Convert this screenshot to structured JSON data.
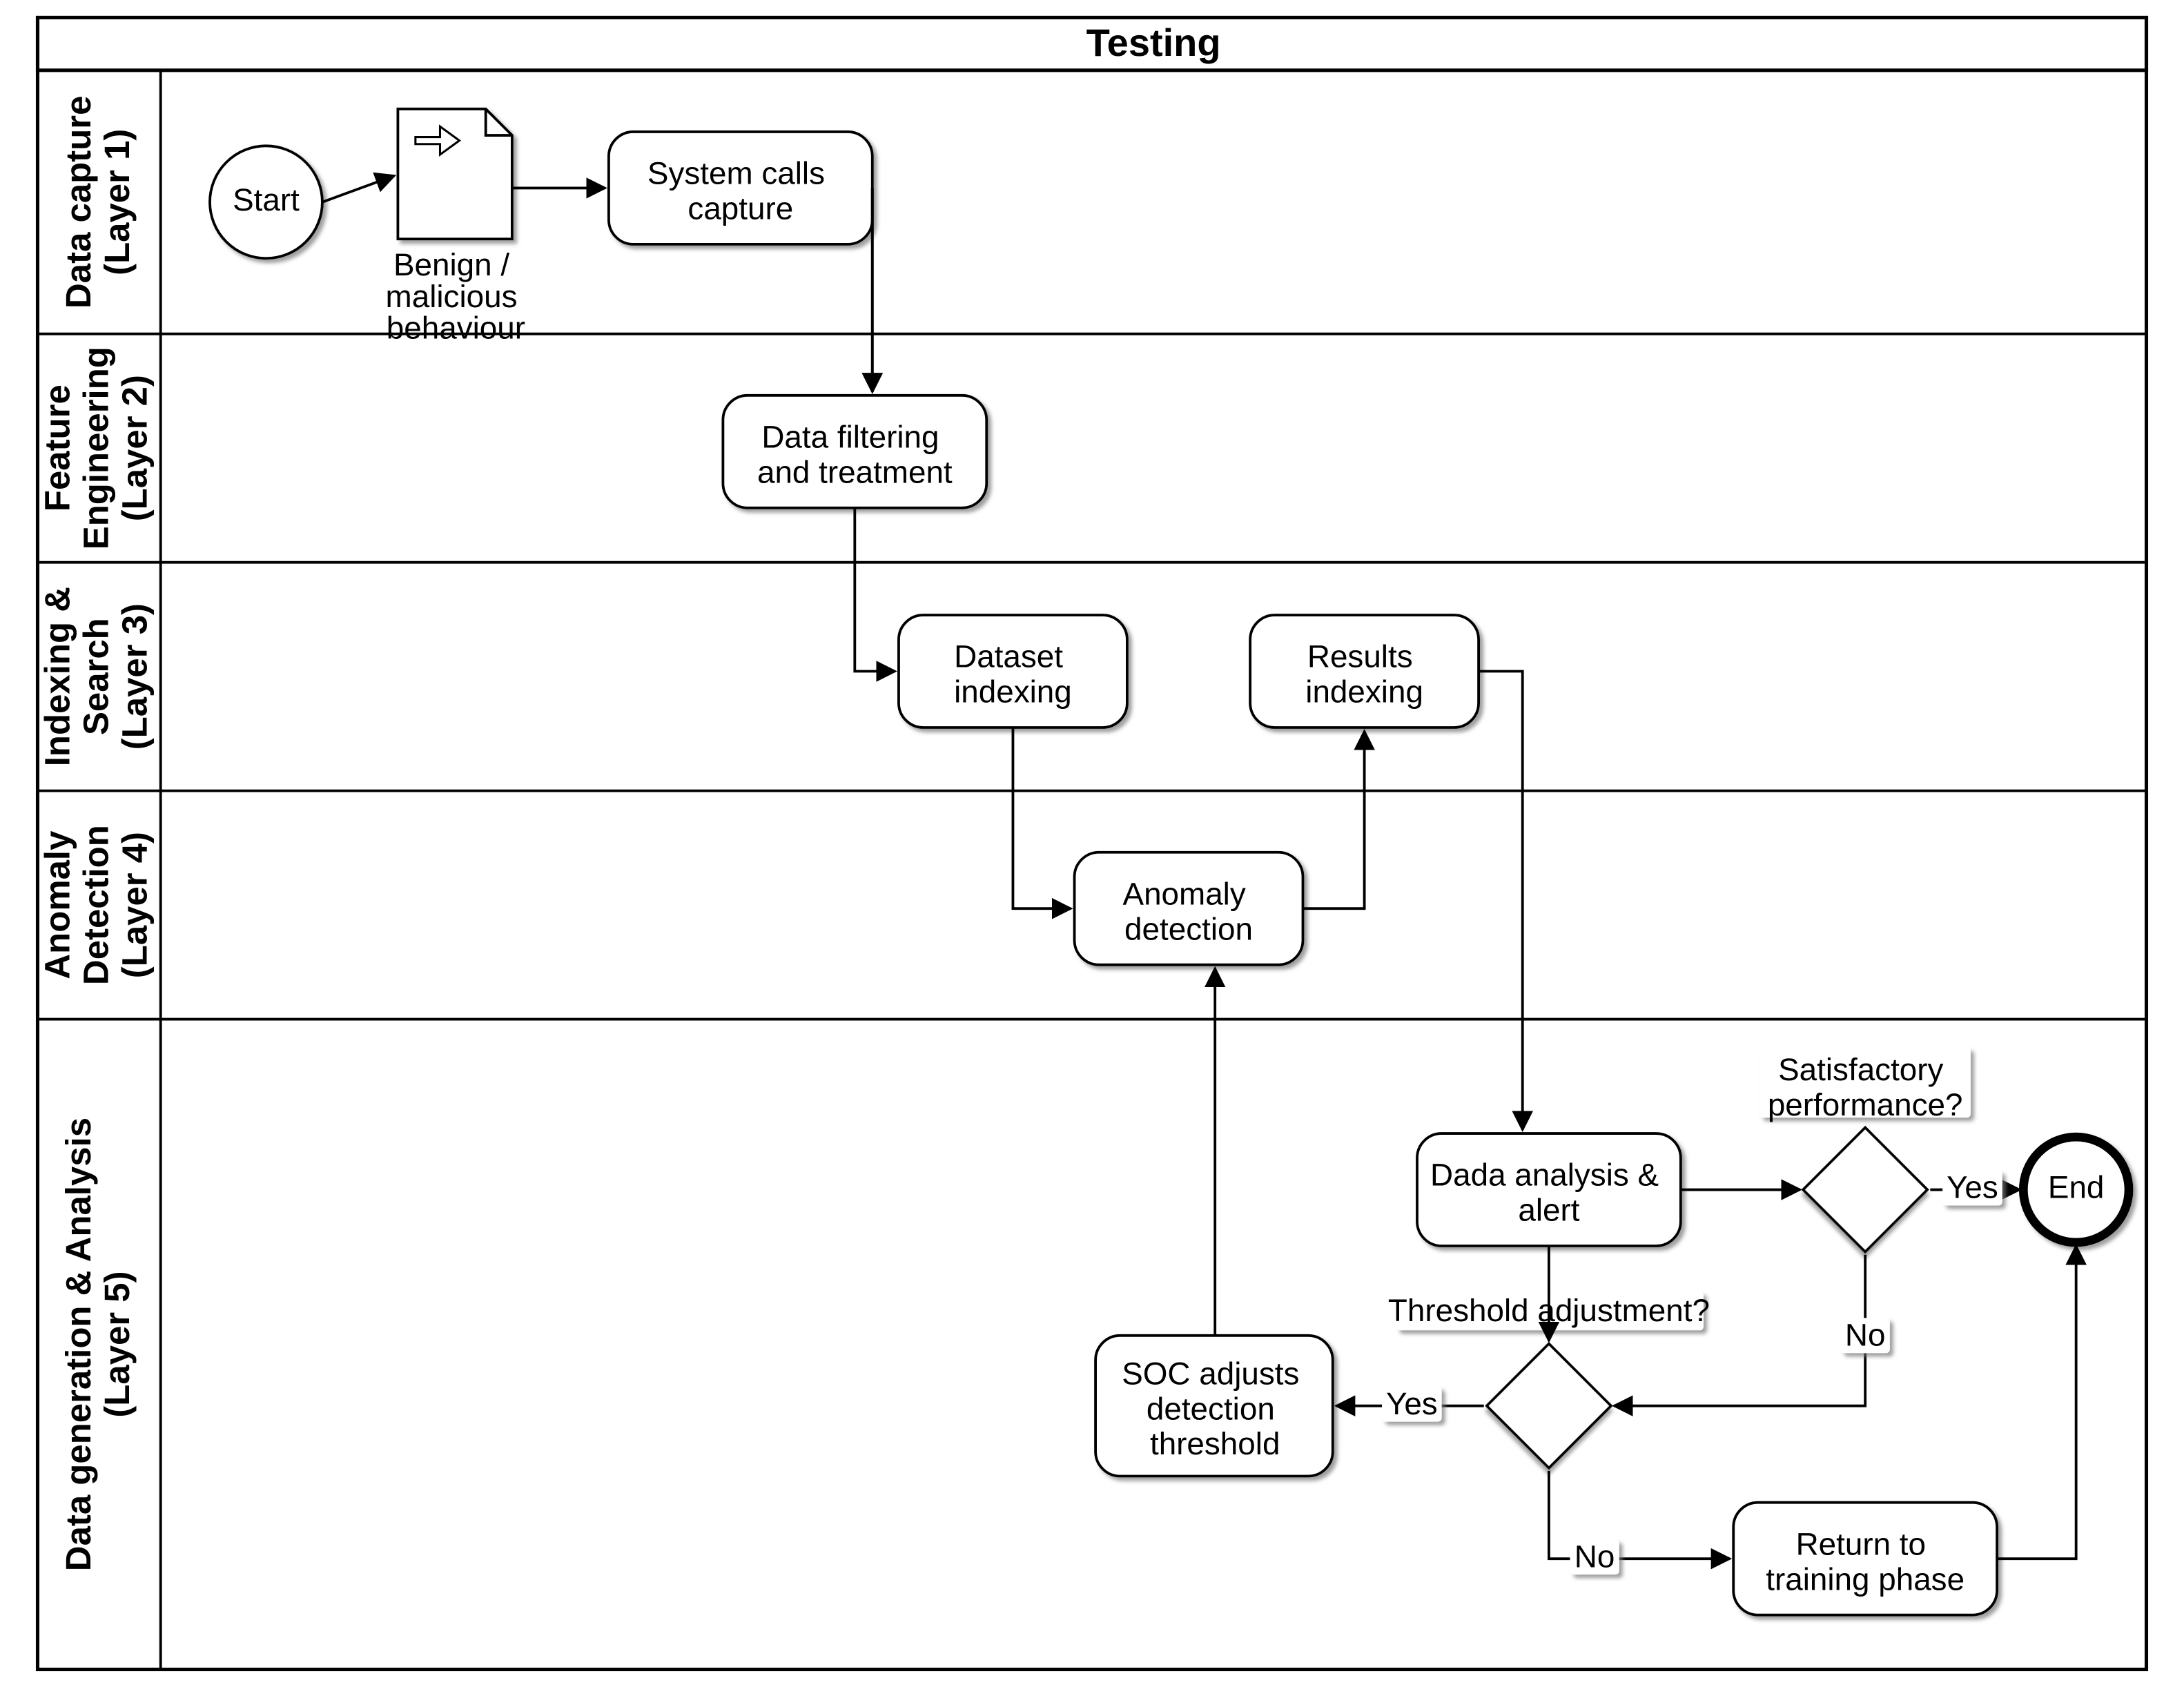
{
  "pool": {
    "title": "Testing"
  },
  "lanes": [
    {
      "label1": "Data capture",
      "label2": "(Layer 1)"
    },
    {
      "label1": "Feature",
      "label2": "Engineering",
      "label3": "(Layer 2)"
    },
    {
      "label1": "Indexing &",
      "label2": "Search",
      "label3": "(Layer 3)"
    },
    {
      "label1": "Anomaly",
      "label2": "Detection",
      "label3": "(Layer 4)"
    },
    {
      "label1": "Data generation & Analysis",
      "label2": "(Layer 5)"
    }
  ],
  "nodes": {
    "start": "Start",
    "doc": {
      "line1": "Benign  /",
      "line2": "malicious",
      "line3": "behaviour"
    },
    "syscalls": {
      "line1": "System calls",
      "line2": "capture"
    },
    "filter": {
      "line1": "Data filtering",
      "line2": "and treatment"
    },
    "dataset_idx": {
      "line1": "Dataset",
      "line2": "indexing"
    },
    "results_idx": {
      "line1": "Results",
      "line2": "indexing"
    },
    "anomaly": {
      "line1": "Anomaly",
      "line2": "detection"
    },
    "analysis": {
      "line1": "Dada analysis &",
      "line2": "alert"
    },
    "adjust": {
      "line1": "SOC adjusts",
      "line2": "detection",
      "line3": "threshold"
    },
    "return": {
      "line1": "Return to",
      "line2": "training phase"
    },
    "end": "End"
  },
  "gateways": {
    "satisfactory": {
      "line1": "Satisfactory",
      "line2": "performance?"
    },
    "threshold": "Threshold adjustment?"
  },
  "edges": {
    "yes": "Yes",
    "no": "No"
  }
}
